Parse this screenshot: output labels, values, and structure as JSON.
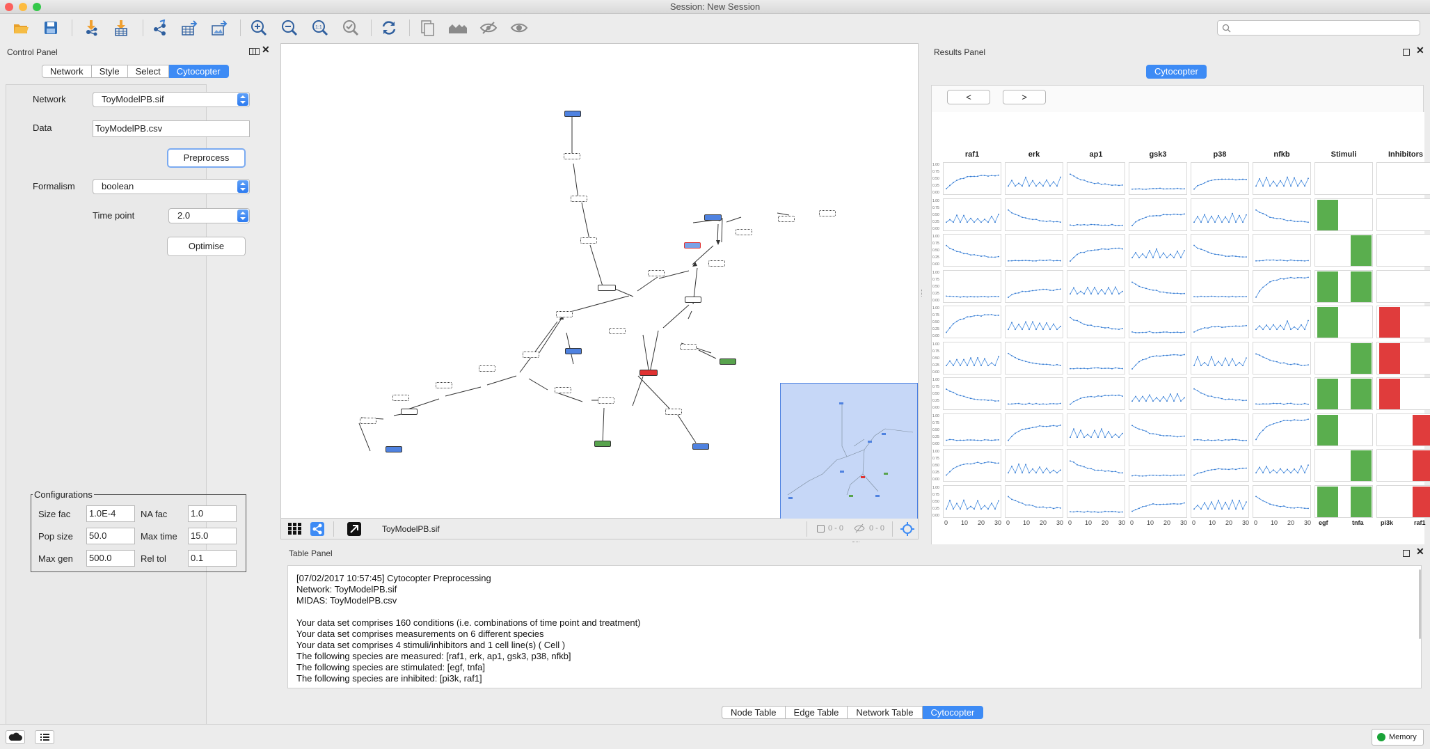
{
  "window": {
    "title": "Session: New Session"
  },
  "toolbar": {
    "buttons": [
      "open-session-icon",
      "save-session-icon",
      "import-network-icon",
      "import-table-icon",
      "share-network-icon",
      "export-table-icon",
      "export-image-icon",
      "zoom-in-icon",
      "zoom-out-icon",
      "zoom-fit-icon",
      "zoom-selected-icon",
      "refresh-icon",
      "new-network-from-selection-icon",
      "first-neighbors-icon",
      "hide-selected-icon",
      "show-all-icon"
    ],
    "search_placeholder": ""
  },
  "control_panel": {
    "title": "Control Panel",
    "tabs": [
      "Network",
      "Style",
      "Select",
      "Cytocopter"
    ],
    "selected_tab": "Cytocopter",
    "network_label": "Network",
    "network_value": "ToyModelPB.sif",
    "data_label": "Data",
    "data_value": "ToyModelPB.csv",
    "preprocess_label": "Preprocess",
    "formalism_label": "Formalism",
    "formalism_value": "boolean",
    "time_point_label": "Time point",
    "time_point_value": "2.0",
    "optimise_label": "Optimise",
    "config": {
      "title": "Configurations",
      "size_fac_label": "Size fac",
      "size_fac_value": "1.0E-4",
      "na_fac_label": "NA fac",
      "na_fac_value": "1.0",
      "pop_size_label": "Pop size",
      "pop_size_value": "50.0",
      "max_time_label": "Max time",
      "max_time_value": "15.0",
      "max_gen_label": "Max gen",
      "max_gen_value": "500.0",
      "rel_tol_label": "Rel tol",
      "rel_tol_value": "0.1"
    }
  },
  "network_view": {
    "footer_name": "ToyModelPB.sif",
    "selected_count": "0 - 0",
    "hidden_count": "0 - 0",
    "colors": {
      "blue": "#4f82e0",
      "green": "#58a34d",
      "red": "#e03232"
    }
  },
  "results_panel": {
    "title": "Results Panel",
    "tab": "Cytocopter",
    "prev_label": "<",
    "next_label": ">",
    "columns": [
      "raf1",
      "erk",
      "ap1",
      "gsk3",
      "p38",
      "nfkb",
      "Stimuli",
      "Inhibitors"
    ],
    "y_ticks": [
      "1.00",
      "0.75",
      "0.50",
      "0.25",
      "0.00"
    ],
    "x_ticks": [
      "0",
      "10",
      "20",
      "30"
    ],
    "bottom_labels": [
      "egf",
      "tnfa",
      "pi3k",
      "raf1"
    ],
    "stimuli_inhibitor_grid": [
      [
        0,
        0,
        0,
        0
      ],
      [
        1,
        0,
        0,
        0
      ],
      [
        0,
        1,
        0,
        0
      ],
      [
        1,
        1,
        0,
        0
      ],
      [
        1,
        0,
        1,
        0
      ],
      [
        0,
        1,
        1,
        0
      ],
      [
        1,
        1,
        1,
        0
      ],
      [
        1,
        0,
        0,
        1
      ],
      [
        0,
        1,
        0,
        1
      ],
      [
        1,
        1,
        0,
        1
      ]
    ],
    "stimulus_color": "#5aae4e",
    "inhibitor_color": "#e03c3c"
  },
  "table_panel": {
    "title": "Table Panel",
    "lines": [
      "[07/02/2017 10:57:45] Cytocopter Preprocessing",
      "Network: ToyModelPB.sif",
      "MIDAS: ToyModelPB.csv",
      "",
      "Your data set comprises 160 conditions (i.e. combinations of time point and treatment)",
      "Your data set comprises measurements on 6 different species",
      "Your data set comprises 4 stimuli/inhibitors and 1 cell line(s) ( Cell )",
      "The following species are measured: [raf1, erk, ap1, gsk3, p38, nfkb]",
      "The following species are stimulated: [egf, tnfa]",
      "The following species are inhibited: [pi3k, raf1]"
    ],
    "tabs": [
      "Node Table",
      "Edge Table",
      "Network Table",
      "Cytocopter"
    ],
    "selected_tab": "Cytocopter"
  },
  "status_bar": {
    "memory_label": "Memory"
  }
}
